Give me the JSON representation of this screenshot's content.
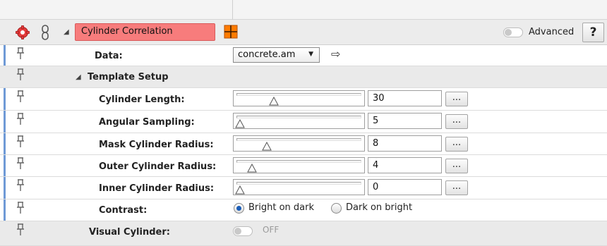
{
  "module": {
    "name": "Cylinder Correlation",
    "advanced_label": "Advanced",
    "advanced_state": false,
    "help_label": "?"
  },
  "data_port": {
    "label": "Data:",
    "value": "concrete.am"
  },
  "template_setup": {
    "label": "Template Setup",
    "params": [
      {
        "label": "Cylinder Length:",
        "value": "30",
        "slider_fraction": 0.29
      },
      {
        "label": "Angular Sampling:",
        "value": "5",
        "slider_fraction": 0.0
      },
      {
        "label": "Mask Cylinder Radius:",
        "value": "8",
        "slider_fraction": 0.23
      },
      {
        "label": "Outer Cylinder Radius:",
        "value": "4",
        "slider_fraction": 0.1
      },
      {
        "label": "Inner Cylinder Radius:",
        "value": "0",
        "slider_fraction": 0.0
      }
    ],
    "more_label": "..."
  },
  "contrast": {
    "label": "Contrast:",
    "options": [
      "Bright on dark",
      "Dark on bright"
    ],
    "selected": "Bright on dark"
  },
  "visual_cylinder": {
    "label": "Visual Cylinder:",
    "state": "OFF"
  },
  "colors": {
    "module_name_bg": "#f77c7c",
    "accent": "#6f9ad6",
    "radio_selected": "#1a5db8"
  }
}
